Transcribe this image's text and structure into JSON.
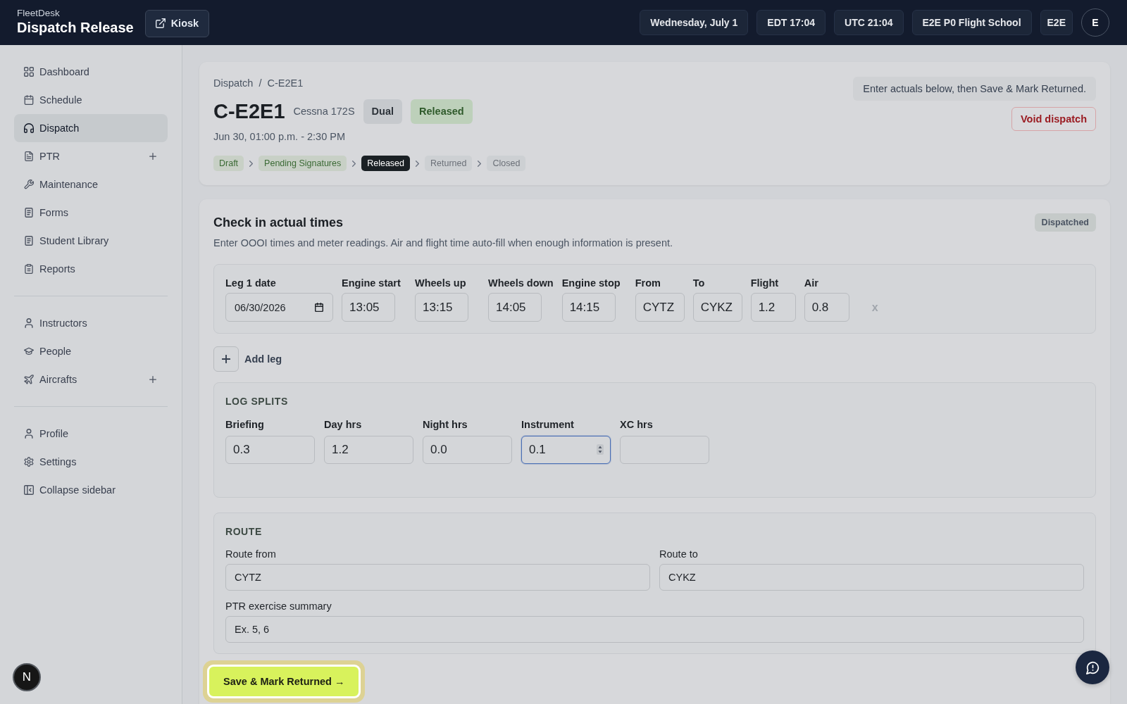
{
  "app_bar": {
    "brand": "FleetDesk",
    "title": "Dispatch Release",
    "kiosk_button": "Kiosk",
    "chips": [
      "Wednesday, July 1",
      "EDT 17:04",
      "UTC 21:04",
      "E2E P0 Flight School",
      "E2E"
    ],
    "avatar": "E"
  },
  "sidebar": {
    "groups": [
      {
        "items": [
          {
            "label": "Dashboard",
            "selected": false,
            "add_button": false
          },
          {
            "label": "Schedule",
            "selected": false,
            "add_button": false
          },
          {
            "label": "Dispatch",
            "selected": true,
            "add_button": false
          },
          {
            "label": "PTR",
            "selected": false,
            "add_button": true
          },
          {
            "label": "Maintenance",
            "selected": false,
            "add_button": false
          },
          {
            "label": "Forms",
            "selected": false,
            "add_button": false
          },
          {
            "label": "Student Library",
            "selected": false,
            "add_button": false
          },
          {
            "label": "Reports",
            "selected": false,
            "add_button": false
          }
        ]
      },
      {
        "items": [
          {
            "label": "Instructors",
            "selected": false,
            "add_button": false
          },
          {
            "label": "People",
            "selected": false,
            "add_button": false
          },
          {
            "label": "Aircrafts",
            "selected": false,
            "add_button": true
          }
        ]
      },
      {
        "items": [
          {
            "label": "Profile",
            "selected": false,
            "add_button": false
          },
          {
            "label": "Settings",
            "selected": false,
            "add_button": false
          },
          {
            "label": "Collapse sidebar",
            "selected": false,
            "add_button": false
          }
        ]
      }
    ]
  },
  "dispatch": {
    "breadcrumb": {
      "items": [
        "Dispatch",
        "C-E2E1"
      ],
      "separator": "/"
    },
    "tail_number": "C-E2E1",
    "aircraft_type": "Cessna 172S",
    "badges": [
      {
        "label": "Dual",
        "kind": "neutral"
      },
      {
        "label": "Released",
        "kind": "success"
      }
    ],
    "time_range": "Jun 30, 01:00 p.m. - 2:30 PM",
    "steps": [
      {
        "label": "Draft",
        "completed": true,
        "selected": false
      },
      {
        "label": "Pending Signatures",
        "completed": true,
        "selected": false
      },
      {
        "label": "Released",
        "completed": false,
        "selected": true
      },
      {
        "label": "Returned",
        "completed": false,
        "selected": false
      },
      {
        "label": "Closed",
        "completed": false,
        "selected": false
      }
    ],
    "notice": "Enter actuals below, then Save & Mark Returned.",
    "void_button": "Void dispatch"
  },
  "checkin": {
    "title": "Check in actual times",
    "status_badge": "Dispatched",
    "description": "Enter OOOI times and meter readings. Air and flight time auto-fill when enough information is present.",
    "legs": [
      {
        "fields": [
          {
            "label": "Leg 1 date",
            "value": "06/30/2026",
            "kind": "date"
          },
          {
            "label": "Engine start",
            "value": "13:05",
            "kind": "time"
          },
          {
            "label": "Wheels up",
            "value": "13:15",
            "kind": "time"
          },
          {
            "label": "Wheels down",
            "value": "14:05",
            "kind": "time"
          },
          {
            "label": "Engine stop",
            "value": "14:15",
            "kind": "time"
          },
          {
            "label": "From",
            "value": "CYTZ",
            "kind": "airport"
          },
          {
            "label": "To",
            "value": "CYKZ",
            "kind": "airport"
          },
          {
            "label": "Flight",
            "value": "1.2",
            "kind": "hours"
          },
          {
            "label": "Air",
            "value": "0.8",
            "kind": "hours"
          }
        ],
        "remove_button": "x"
      }
    ],
    "add_leg_button": "Add leg",
    "log_splits": {
      "title": "LOG SPLITS",
      "fields": [
        {
          "label": "Briefing",
          "value": "0.3",
          "focused": false
        },
        {
          "label": "Day hrs",
          "value": "1.2",
          "focused": false
        },
        {
          "label": "Night hrs",
          "value": "0.0",
          "focused": false
        },
        {
          "label": "Instrument",
          "value": "0.1",
          "focused": true
        },
        {
          "label": "XC hrs",
          "focused": false
        }
      ]
    },
    "route": {
      "title": "ROUTE",
      "rows": [
        [
          {
            "label": "Route from",
            "value": "CYTZ"
          },
          {
            "label": "Route to",
            "value": "CYKZ"
          }
        ],
        [
          {
            "label": "PTR exercise summary",
            "value": "Ex. 5, 6"
          }
        ]
      ]
    },
    "save_button": "Save & Mark Returned →"
  },
  "dev_indicator": "N"
}
